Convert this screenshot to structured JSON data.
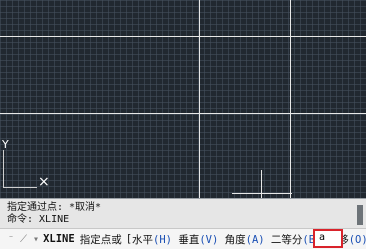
{
  "history": {
    "line1": "指定通过点: *取消*",
    "line2": "命令:  XLINE"
  },
  "command": {
    "icon": "command-icon",
    "name": "XLINE",
    "prompt": "指定点或",
    "bracket_open": "[",
    "opt1": "水平",
    "key1": "(H)",
    "opt2": "垂直",
    "key2": "(V)",
    "opt3": "角度",
    "key3": "(A)",
    "opt4": "二等分",
    "key4": "(B)",
    "opt5": "偏移",
    "key5": "(O)",
    "bracket_close": "]:",
    "input_value": "a"
  },
  "ucs": {
    "y_label": "Y",
    "x_label": "×"
  }
}
